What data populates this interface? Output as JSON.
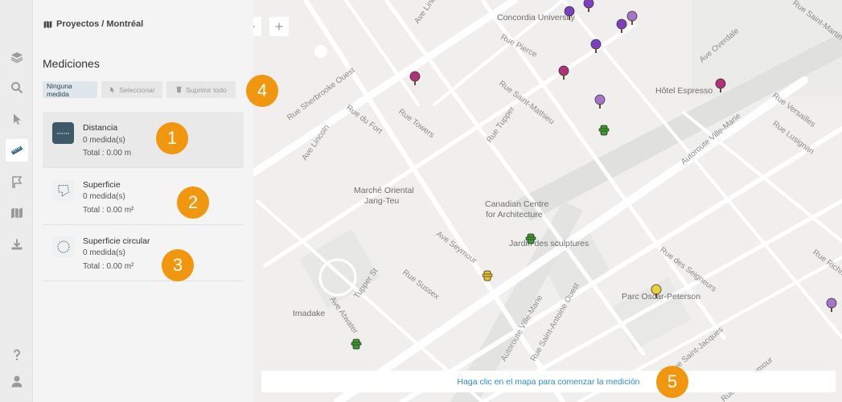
{
  "breadcrumb": {
    "text": "Proyectos / Montréal"
  },
  "panel": {
    "title": "Mediciones"
  },
  "toolbar": {
    "none_label": "Ninguna medida",
    "select_label": "Seleccionar",
    "delete_all_label": "Suprimir todo"
  },
  "tools": [
    {
      "name": "Distancia",
      "count": "0 medida(s)",
      "total": "Total : 0.00 m"
    },
    {
      "name": "Superficie",
      "count": "0 medida(s)",
      "total": "Total : 0.00 m²"
    },
    {
      "name": "Superficie circular",
      "count": "0 medida(s)",
      "total": "Total : 0.00 m²"
    }
  ],
  "callouts": [
    "1",
    "2",
    "3",
    "4",
    "5"
  ],
  "map": {
    "hint": "Haga clic en el mapa para comenzar la medición",
    "streets": [
      "Concordia University",
      "Rue Pierce",
      "Ave Lincoln",
      "Rue Sherbrooke Ouest",
      "Rue du Fort",
      "Ave Lincoln",
      "Rue Towers",
      "Rue Saint-Mathieu",
      "Rue Tupper",
      "Ave Overdale",
      "Rue Versailles",
      "Rue Lusignan",
      "Rue Saint-Martin",
      "Autoroute Ville-Marie",
      "Rue Ave Seymour",
      "Rue Sussex",
      "Ave Seymour",
      "Tupper St",
      "Ave Atwater",
      "Autoroute Ville-Marie",
      "Rue Saint-Antoine Ouest",
      "Rue des Seigneurs",
      "Rue Richmond",
      "Rue Saint-Jacques",
      "Hôtel Espresso",
      "Marché Oriental",
      "Jang-Teu",
      "Canadian Centre",
      "for Architecture",
      "Jardin des sculptures",
      "Parc Oscar-Peterson",
      "Imadake"
    ]
  },
  "colors": {
    "accent": "#f0960f",
    "tool_active": "#3e5967",
    "hint_text": "#2d8bcf",
    "tree_purple": "#7b3fbf",
    "tree_magenta": "#b0307a",
    "tree_lilac": "#a674c9",
    "tree_yellow": "#e8d23a",
    "hydrant_green": "#3b9c2c",
    "hydrant_yellow": "#e8c22a"
  },
  "icons": {
    "rail": [
      "layers-icon",
      "search-icon",
      "pointer-icon",
      "ruler-icon",
      "flag-icon",
      "map-icon",
      "download-icon",
      "help-icon",
      "user-icon"
    ],
    "map_controls": [
      "arrow-left-icon",
      "plus-icon"
    ]
  }
}
